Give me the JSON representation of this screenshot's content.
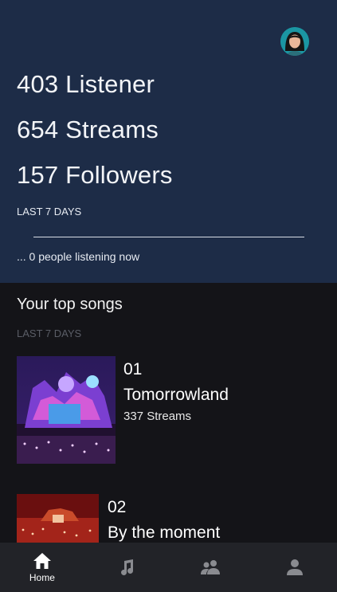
{
  "header": {
    "listeners": "403 Listener",
    "streams": "654 Streams",
    "followers": "157 Followers",
    "period": "LAST 7 DAYS",
    "listening_now": "... 0 people listening now"
  },
  "top_songs": {
    "title": "Your top songs",
    "period": "LAST 7 DAYS",
    "items": [
      {
        "rank": "01",
        "title": "Tomorrowland",
        "streams": "337 Streams"
      },
      {
        "rank": "02",
        "title": "By the moment",
        "streams": ""
      }
    ]
  },
  "nav": {
    "items": [
      {
        "label": "Home",
        "icon": "home-icon",
        "active": true
      },
      {
        "label": "",
        "icon": "music-note-icon",
        "active": false
      },
      {
        "label": "",
        "icon": "people-icon",
        "active": false
      },
      {
        "label": "",
        "icon": "person-icon",
        "active": false
      }
    ]
  },
  "colors": {
    "header_bg": "#1d2c47",
    "body_bg": "#141418",
    "navbar_bg": "#222328"
  }
}
